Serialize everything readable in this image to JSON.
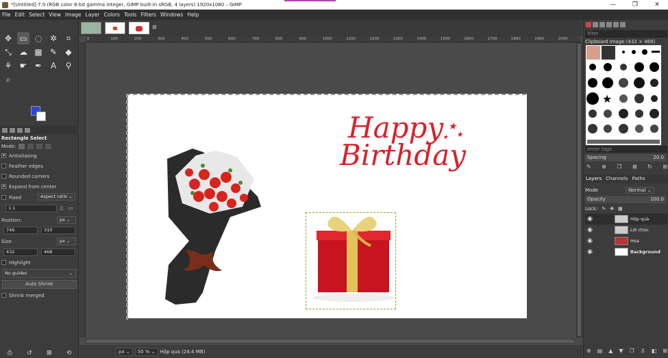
{
  "window": {
    "title": "*[Untitled]-7.0 (RGB color 8-bit gamma integer, GIMP built-in sRGB, 4 layers) 1920x1080 – GIMP",
    "minimize": "—",
    "maximize": "❐",
    "close": "✕"
  },
  "menu": [
    "File",
    "Edit",
    "Select",
    "View",
    "Image",
    "Layer",
    "Colors",
    "Tools",
    "Filters",
    "Windows",
    "Help"
  ],
  "tool_options": {
    "title": "Rectangle Select",
    "mode_label": "Mode:",
    "antialiasing": "Antialiasing",
    "feather_edges": "Feather edges",
    "rounded_corners": "Rounded corners",
    "expand_from_center": "Expand from center",
    "fixed_label": "Fixed",
    "fixed_value": "Aspect ratio",
    "ratio_value": "1:1",
    "position_label": "Position:",
    "position_unit": "px",
    "pos_x": "746",
    "pos_y": "310",
    "size_label": "Size:",
    "size_unit": "px",
    "size_w": "432",
    "size_h": "468",
    "highlight": "Highlight",
    "guides": "No guides",
    "auto_shrink": "Auto Shrink",
    "shrink_merged": "Shrink merged"
  },
  "ruler_ticks": [
    "0",
    "100",
    "200",
    "300",
    "400",
    "500",
    "600",
    "700",
    "800",
    "900",
    "1000",
    "1100",
    "1200",
    "1300",
    "1400",
    "1500",
    "1600",
    "1700",
    "1800",
    "1900",
    "2000"
  ],
  "canvas": {
    "birthday_line1": "Happy",
    "birthday_line2": "Birthday"
  },
  "status": {
    "unit": "px",
    "zoom": "50 %",
    "info": "Hộp quà (24.4 MB)"
  },
  "brushes": {
    "filter_placeholder": "filter",
    "title": "Clipboard Image (432 × 468)",
    "tags_placeholder": "enter tags",
    "spacing_label": "Spacing",
    "spacing_value": "20.0"
  },
  "layers": {
    "tabs": [
      "Layers",
      "Channels",
      "Paths"
    ],
    "mode_label": "Mode",
    "mode_value": "Normal",
    "opacity_label": "Opacity",
    "opacity_value": "100.0",
    "lock_label": "Lock:",
    "items": [
      {
        "name": "Hộp quà",
        "selected": true
      },
      {
        "name": "Lời chúc",
        "selected": false
      },
      {
        "name": "Hoa",
        "selected": false
      },
      {
        "name": "Background",
        "selected": false
      }
    ]
  },
  "colors": {
    "foreground": "#2a46d8",
    "background": "#ffffff",
    "text_red": "#d8202a"
  }
}
